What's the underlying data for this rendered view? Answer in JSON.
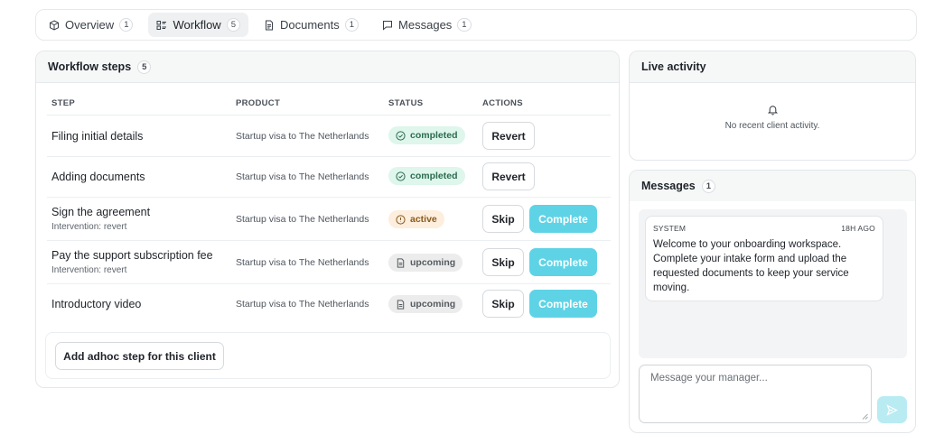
{
  "tabs": [
    {
      "label": "Overview",
      "count": "1",
      "icon": "box-icon"
    },
    {
      "label": "Workflow",
      "count": "5",
      "icon": "list-icon"
    },
    {
      "label": "Documents",
      "count": "1",
      "icon": "document-icon"
    },
    {
      "label": "Messages",
      "count": "1",
      "icon": "chat-icon"
    }
  ],
  "workflow": {
    "title": "Workflow steps",
    "count": "5",
    "columns": [
      "STEP",
      "PRODUCT",
      "STATUS",
      "ACTIONS"
    ],
    "rows": [
      {
        "title": "Filing initial details",
        "sub": "",
        "product": "Startup visa to The Netherlands",
        "status": "completed",
        "actions": [
          "Revert"
        ]
      },
      {
        "title": "Adding documents",
        "sub": "",
        "product": "Startup visa to The Netherlands",
        "status": "completed",
        "actions": [
          "Revert"
        ]
      },
      {
        "title": "Sign the agreement",
        "sub": "Intervention: revert",
        "product": "Startup visa to The Netherlands",
        "status": "active",
        "actions": [
          "Skip",
          "Complete"
        ]
      },
      {
        "title": "Pay the support subscription fee",
        "sub": "Intervention: revert",
        "product": "Startup visa to The Netherlands",
        "status": "upcoming",
        "actions": [
          "Skip",
          "Complete"
        ]
      },
      {
        "title": "Introductory video",
        "sub": "",
        "product": "Startup visa to The Netherlands",
        "status": "upcoming",
        "actions": [
          "Skip",
          "Complete"
        ]
      }
    ],
    "adhoc_label": "Add adhoc step for this client"
  },
  "live_activity": {
    "title": "Live activity",
    "empty_text": "No recent client activity."
  },
  "messages": {
    "title": "Messages",
    "count": "1",
    "items": [
      {
        "sender": "SYSTEM",
        "time": "18H AGO",
        "text": "Welcome to your onboarding workspace. Complete your intake form and upload the requested documents to keep your service moving."
      }
    ],
    "placeholder": "Message your manager..."
  },
  "colors": {
    "accent": "#5fd3e6",
    "completed_bg": "#def6ec",
    "active_bg": "#fdeedd",
    "upcoming_bg": "#ececec"
  }
}
